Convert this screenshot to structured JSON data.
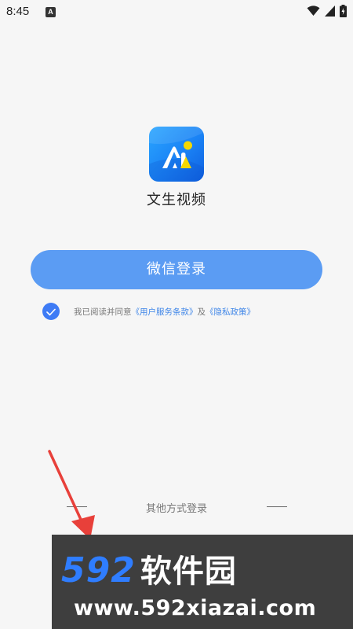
{
  "status_bar": {
    "time": "8:45",
    "notification_icon": "A",
    "wifi": "wifi-icon",
    "signal": "signal-icon",
    "battery": "battery-icon"
  },
  "app": {
    "name": "文生视频",
    "icon": "ai-app-icon",
    "icon_colors": {
      "gradient_start": "#2aa6ff",
      "gradient_end": "#0f5fe0",
      "letter": "#ffffff",
      "triangle": "#f5d800"
    }
  },
  "login": {
    "wechat_button": "微信登录",
    "button_color": "#5b9cf3",
    "agreement": {
      "checked": true,
      "prefix": "我已阅读并同意",
      "user_terms": "《用户服务条款》",
      "connector": "及",
      "privacy_policy": "《隐私政策》"
    },
    "other_methods": "其他方式登录"
  },
  "annotation": {
    "arrow_color": "#e8403a"
  },
  "watermark": {
    "brand": "592",
    "brand_cn": "软件园",
    "url": "www.592xiazai.com"
  }
}
